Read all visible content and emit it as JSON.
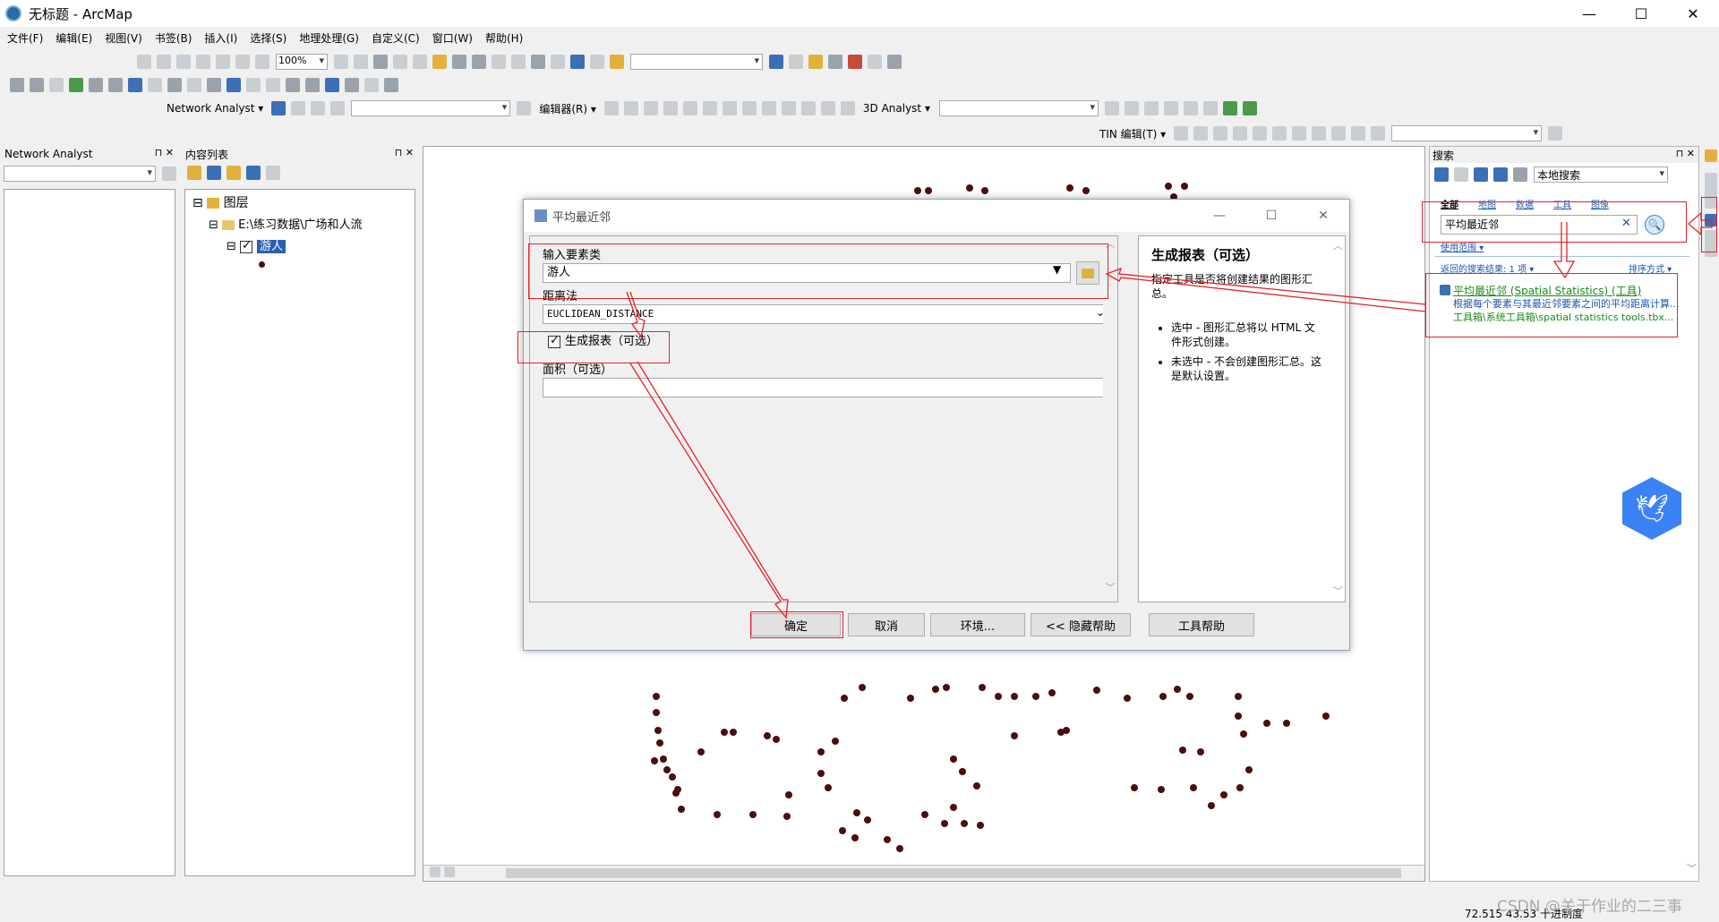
{
  "window": {
    "title": "无标题 - ArcMap",
    "min": "—",
    "max": "☐",
    "close": "✕"
  },
  "menu": [
    "文件(F)",
    "编辑(E)",
    "视图(V)",
    "书签(B)",
    "插入(I)",
    "选择(S)",
    "地理处理(G)",
    "自定义(C)",
    "窗口(W)",
    "帮助(H)"
  ],
  "toolbar": {
    "zoom": "100%",
    "network_analyst": "Network Analyst ▾",
    "editor": "编辑器(R) ▾",
    "analyst3d": "3D Analyst ▾",
    "tin_edit": "TIN 编辑(T) ▾"
  },
  "na_panel": {
    "title": "Network Analyst",
    "pins": "⊓ ✕"
  },
  "toc": {
    "title": "内容列表",
    "pins": "⊓ ✕",
    "layers": "图层",
    "path": "E:\\练习数据\\广场和人流",
    "layer": "游人"
  },
  "dialog": {
    "title": "平均最近邻",
    "input_label": "输入要素类",
    "input_value": "游人",
    "distance_label": "距离法",
    "distance_value": "EUCLIDEAN_DISTANCE",
    "report_label": "生成报表（可选）",
    "area_label": "面积（可选）",
    "buttons": {
      "ok": "确定",
      "cancel": "取消",
      "env": "环境...",
      "hide": "<< 隐藏帮助",
      "toolhelp": "工具帮助"
    },
    "help_title": "生成报表（可选）",
    "help_text": "指定工具是否将创建结果的图形汇总。",
    "help_bullets": [
      "选中 - 图形汇总将以 HTML 文件形式创建。",
      "未选中 - 不会创建图形汇总。这是默认设置。"
    ]
  },
  "search": {
    "title": "搜索",
    "pins": "⊓ ✕",
    "scope": "本地搜索",
    "tabs": [
      "全部",
      "地图",
      "数据",
      "工具",
      "图像"
    ],
    "query": "平均最近邻",
    "scope_link": "使用范围 ▾",
    "result_count": "返回的搜索结果: 1 项 ▾",
    "sort": "排序方式 ▾",
    "result_title": "平均最近邻 (Spatial Statistics) (工具)",
    "result_desc": "根据每个要素与其最近邻要素之间的平均距离计算...",
    "result_path": "工具箱\\系统工具箱\\spatial statistics tools.tbx..."
  },
  "status": {
    "coords": "72.515  43.53 十进制度",
    "watermark": "CSDN @关于作业的二三事"
  },
  "colors": {
    "red_annotation": "#e0242a",
    "point": "#4b0d0d",
    "accent": "#1a56b0"
  }
}
